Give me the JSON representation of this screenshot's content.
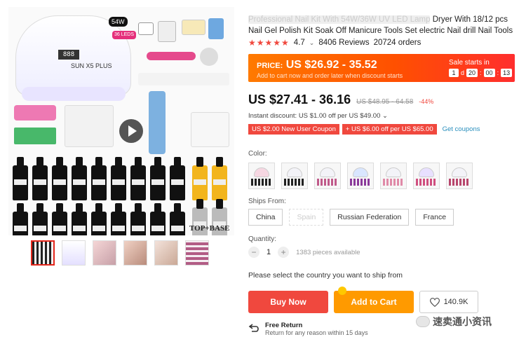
{
  "product": {
    "title_hidden_prefix": "Professional Nail Kit With 54W/36W UV LED Lamp",
    "title": "Dryer With 18/12 pcs Nail Gel Polish Kit Soak Off Manicure Tools Set electric Nail drill Nail Tools",
    "rating": "4.7",
    "reviews": "8406 Reviews",
    "orders": "20724 orders"
  },
  "gallery": {
    "lamp_display": "888",
    "lamp_brand": "SUN X5 PLUS",
    "badge_watt": "54W",
    "badge_leds": "36 LEDS",
    "top_base_label": "TOP+BASE",
    "thumbnail_count": 6
  },
  "promo": {
    "price_label": "PRICE:",
    "price_range": "US $26.92 - 35.52",
    "subtitle": "Add to cart now and order later when discount starts",
    "sale_label": "Sale starts in",
    "days": "1",
    "d": "d",
    "hours": "20",
    "minutes": "00",
    "seconds": "13"
  },
  "price": {
    "current": "US $27.41 - 36.16",
    "original": "US $48.95 - 64.58",
    "discount": "-44%"
  },
  "instant_discount": "Instant discount: US $1.00 off per US $49.00 ⌄",
  "coupons": {
    "c1": "US $2.00 New User Coupon",
    "c2": "+ US $6.00 off per US $65.00",
    "link": "Get coupons"
  },
  "labels": {
    "color": "Color:",
    "ships_from": "Ships From:",
    "quantity": "Quantity:",
    "please_select": "Please select the country you want to ship from"
  },
  "ships_from": {
    "opt1": "China",
    "opt2": "Spain",
    "opt3": "Russian Federation",
    "opt4": "France"
  },
  "quantity": {
    "minus": "−",
    "value": "1",
    "plus": "+",
    "available": "1383 pieces available"
  },
  "actions": {
    "buy": "Buy Now",
    "cart": "Add to Cart",
    "wishlist_count": "140.9K"
  },
  "return": {
    "title": "Free Return",
    "subtitle": "Return for any reason within 15 days"
  },
  "watermark": "速卖通小资讯",
  "colors_hex": {
    "accent": "#f0483e",
    "cart": "#ff9a00",
    "link": "#2a8fbd"
  }
}
